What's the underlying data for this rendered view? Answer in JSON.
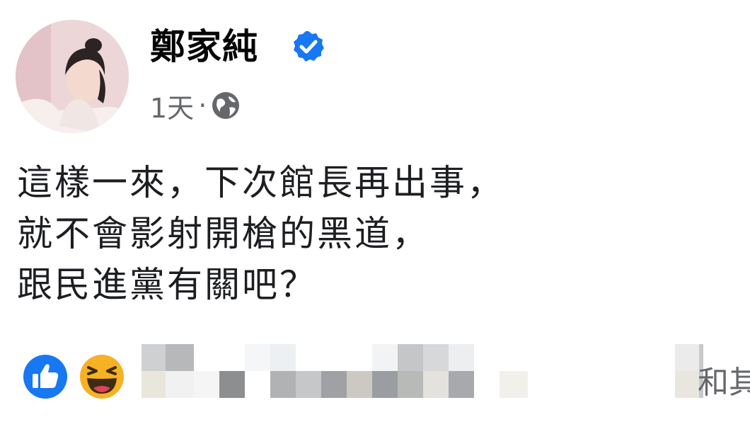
{
  "post": {
    "author": "鄭家純",
    "verified_icon": "verified-badge-icon",
    "timestamp": "1天",
    "separator": "·",
    "audience_icon": "globe-icon",
    "content_lines": [
      "這樣一來，下次館長再出事，",
      "就不會影射開槍的黑道，",
      "跟民進黨有關吧？"
    ]
  },
  "reactions": {
    "icons": [
      "like-reaction-icon",
      "haha-reaction-icon"
    ],
    "others_text": "和其"
  },
  "colors": {
    "verified_blue": "#1877f2",
    "meta_gray": "#65676b",
    "like_blue": "#1877f2",
    "haha_yellow": "#f7b125"
  }
}
